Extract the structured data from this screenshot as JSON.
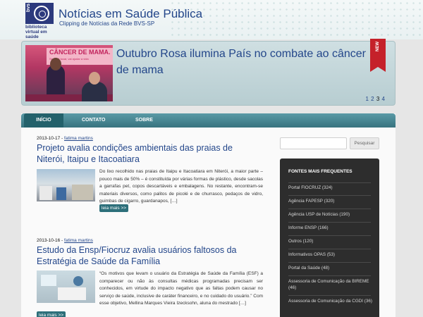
{
  "header": {
    "logo": {
      "mark_text": "bvs",
      "line1": "biblioteca",
      "line2": "virtual em saúde"
    },
    "title": "Notícias em Saúde Pública",
    "subtitle": "Clipping de Notícias da Rede BVS-SP"
  },
  "slider": {
    "image_banner_text": "CÂNCER DE MAMA.",
    "image_banner_sub": "Se você tocar, vai ajudar a vida",
    "title": "Outubro Rosa ilumina País no combate ao câncer de mama",
    "badge": "NEW",
    "pages": [
      "1",
      "2",
      "3",
      "4"
    ],
    "active_page": "3"
  },
  "nav": {
    "home": "INÍCIO",
    "contact": "CONTATO",
    "about": "SOBRE"
  },
  "posts": [
    {
      "date": "2013-10-17",
      "sep": " - ",
      "author": "fatima martins",
      "title": "Projeto avalia condições ambientais das praias de Niterói, Itaipu e Itacoatiara",
      "excerpt": "Do lixo recolhido nas praias de Itaipu e Itacoatiara em Niterói, a maior parte – pouco mais de 50% – é constituída por várias formas de plástico, desde sacolas a garrafas pet, copos descartáveis e embalagens. No restante, encontram-se materiais diversos, como palitos de picolé e de churrasco, pedaços de vidro, guimbas de cigarro, guardanapos, […]",
      "read_more": "leia mais >>"
    },
    {
      "date": "2013-10-16",
      "sep": " - ",
      "author": "fatima martins",
      "title": "Estudo da Ensp/Fiocruz avalia usuários faltosos da Estratégia de Saúde da Família",
      "excerpt": "“Os motivos que levam o usuário da Estratégia de Saúde da Família (ESF) a comparecer ou não às consultas médicas programadas precisam ser conhecidos, em virtude do impacto negativo que as faltas podem causar no serviço de saúde, inclusive de caráter financeiro, e no cuidado do usuário.” Com esse objetivo, Mellina Marques Vieira Izecksohn, aluna do mestrado […]",
      "read_more": "leia mais >>"
    }
  ],
  "sidebar": {
    "search": {
      "value": "",
      "button": "Pesquisar"
    },
    "sources_title": "FONTES MAIS FREQUENTES",
    "sources": [
      "Portal FIOCRUZ (324)",
      "Agência FAPESP (320)",
      "Agência USP de Notícias (190)",
      "Informe ENSP (166)",
      "Outros (120)",
      "Informativos OPAS (53)",
      "Portal da Saúde (48)",
      "Assessoria de Comunicação da BIREME (46)",
      "Assessoria de Comunicação da CGDI (36)"
    ]
  },
  "colors": {
    "brand_blue": "#23468a",
    "nav_teal": "#37737f",
    "ribbon_red": "#c5212a",
    "sidebar_dark": "#2d2d2d"
  }
}
